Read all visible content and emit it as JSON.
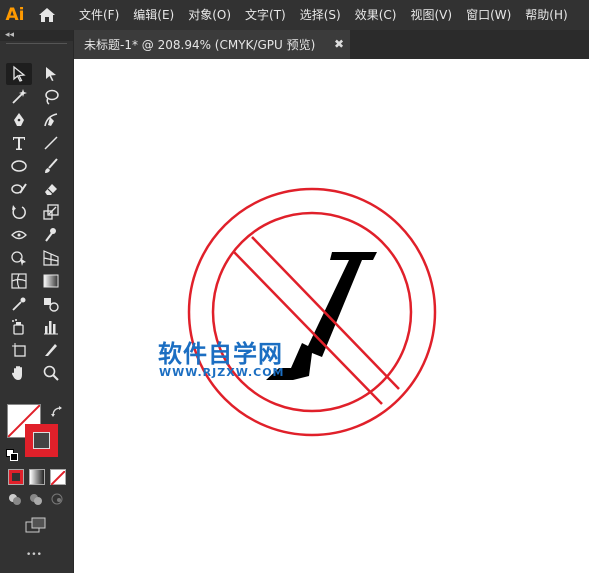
{
  "app": {
    "logo_text": "Ai"
  },
  "menu": {
    "items": [
      "文件(F)",
      "编辑(E)",
      "对象(O)",
      "文字(T)",
      "选择(S)",
      "效果(C)",
      "视图(V)",
      "窗口(W)",
      "帮助(H)"
    ]
  },
  "toolbar": {
    "collapse_label": "◂◂",
    "more_label": "•••"
  },
  "document": {
    "tab_title": "未标题-1* @ 208.94% (CMYK/GPU 预览)",
    "close_label": "✖"
  },
  "watermark": {
    "title": "软件自学网",
    "url": "WWW.RJZXW.COM"
  },
  "colors": {
    "accent_logo": "#ff9a00",
    "stroke_red": "#e0202a",
    "watermark_blue": "#1b6ec2",
    "shape_black": "#000000"
  },
  "icons": [
    "selection-icon",
    "direct-selection-icon",
    "magic-wand-icon",
    "lasso-icon",
    "pen-icon",
    "curvature-icon",
    "type-icon",
    "line-segment-icon",
    "ellipse-icon",
    "paintbrush-icon",
    "shaper-icon",
    "eraser-icon",
    "rotate-icon",
    "scale-icon",
    "width-icon",
    "puppet-warp-icon",
    "shape-builder-icon",
    "perspective-grid-icon",
    "mesh-icon",
    "gradient-icon",
    "eyedropper-icon",
    "blend-icon",
    "symbol-sprayer-icon",
    "column-graph-icon",
    "artboard-icon",
    "slice-icon",
    "hand-icon",
    "zoom-icon"
  ]
}
